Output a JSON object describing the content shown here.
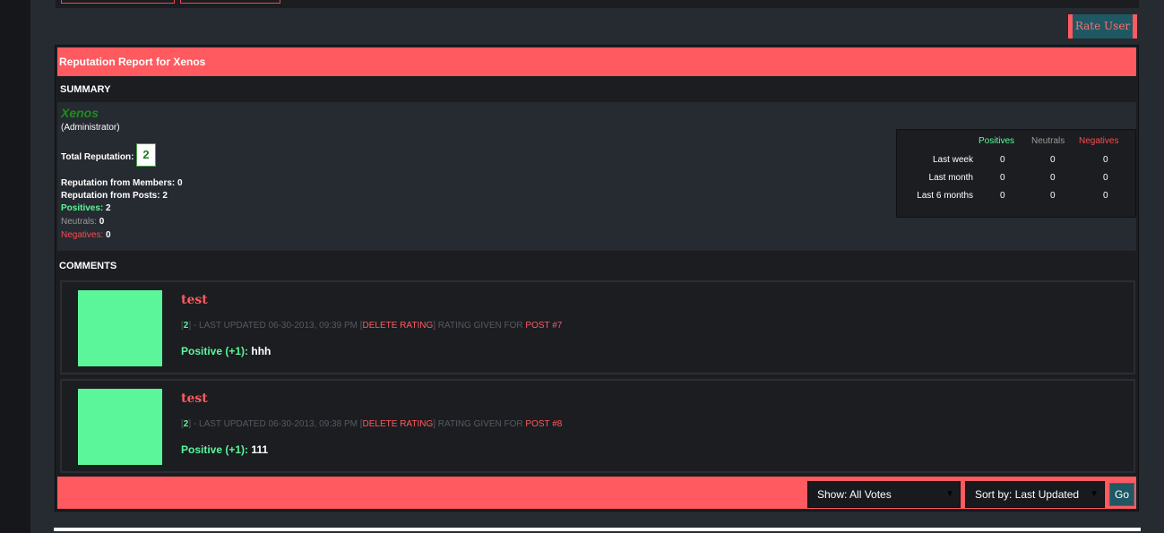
{
  "rate_user_label": "Rate User",
  "report_title": "Reputation Report for Xenos",
  "summary": {
    "label": "SUMMARY",
    "username": "Xenos",
    "role": "(Administrator)",
    "total_label": "Total Reputation:",
    "total_value": "2",
    "from_members_label": "Reputation from Members:",
    "from_members_value": "0",
    "from_posts_label": "Reputation from Posts:",
    "from_posts_value": "2",
    "positives_label": "Positives:",
    "positives_value": "2",
    "neutrals_label": "Neutrals:",
    "neutrals_value": "0",
    "negatives_label": "Negatives:",
    "negatives_value": "0"
  },
  "stats_table": {
    "headers": [
      "Positives",
      "Neutrals",
      "Negatives"
    ],
    "rows": [
      {
        "label": "Last week",
        "values": [
          "0",
          "0",
          "0"
        ]
      },
      {
        "label": "Last month",
        "values": [
          "0",
          "0",
          "0"
        ]
      },
      {
        "label": "Last 6 months",
        "values": [
          "0",
          "0",
          "0"
        ]
      }
    ]
  },
  "comments_label": "COMMENTS",
  "comments": [
    {
      "title": "test",
      "rating_num": "2",
      "meta_updated": "- LAST UPDATED 06-30-2013, 09:39 PM",
      "delete_label": "DELETE RATING",
      "given_for": "RATING GIVEN FOR",
      "post_link": "POST #7",
      "type": "Positive (+1):",
      "text": "hhh"
    },
    {
      "title": "test",
      "rating_num": "2",
      "meta_updated": "- LAST UPDATED 06-30-2013, 09:38 PM",
      "delete_label": "DELETE RATING",
      "given_for": "RATING GIVEN FOR",
      "post_link": "POST #8",
      "type": "Positive (+1):",
      "text": "111"
    }
  ],
  "footer": {
    "show_select": "Show: All Votes",
    "sort_select": "Sort by: Last Updated",
    "go_label": "Go"
  },
  "colors": {
    "accent": "#ff5a5f",
    "positive": "#5cf69a",
    "negative": "#ff4b4b",
    "button_teal": "#1f5763"
  }
}
